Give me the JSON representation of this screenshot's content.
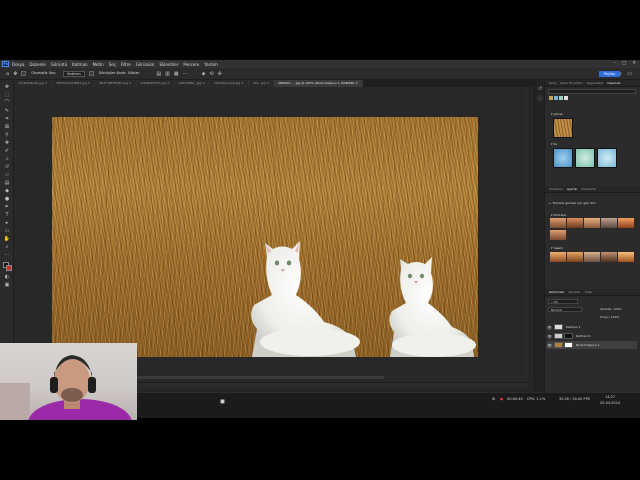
{
  "menubar": {
    "app_icon": "Ps",
    "items": [
      "Dosya",
      "Düzenle",
      "Görüntü",
      "Katman",
      "Metin",
      "Seç",
      "Filtre",
      "Görünüm",
      "Eklentiler",
      "Pencere",
      "Yardım"
    ],
    "window_controls": [
      "–",
      "□",
      "✕"
    ]
  },
  "options": {
    "sample": "Otomatik Seç:",
    "layer_mode": "Katman",
    "show_transform": "Dönüşüm Kontr. Göster",
    "share_label": "Paylaş"
  },
  "tabs": [
    {
      "label": "2376f0d4e4b.jpg ✕",
      "active": false
    },
    {
      "label": "4EF0C01A53B8A.jpg ✕",
      "active": false
    },
    {
      "label": "9B2F4EEEFABD.jpg ✕",
      "active": false
    },
    {
      "label": "2CDB4DAFF1.jpg ✕",
      "active": false
    },
    {
      "label": "1E8C9AB0_.jpg ✕",
      "active": false
    },
    {
      "label": "c5e2f49e-ba6.jpg ✕",
      "active": false
    },
    {
      "label": "c69...jpg ✕",
      "active": false
    },
    {
      "label": "AB8263-..., jpg @ 100% (Renk Dolgusu 1, RGB/8#) ✕",
      "active": true
    }
  ],
  "status": {
    "zoom": "100%"
  },
  "right_panel": {
    "top_tabs": [
      "Renk",
      "Renk Örnekleri",
      "Degradeler",
      "Desenler"
    ],
    "pattern_groups": [
      {
        "name": "Çimen"
      },
      {
        "name": "Su"
      }
    ],
    "mid_tabs": [
      "Özellikler",
      "Ayarlar",
      "Kitaplıklar"
    ],
    "adjust_header": "Tümünü gizmek için geri dön",
    "adjust_groups": [
      "Portreler",
      "Yaşam"
    ],
    "layers_tabs": [
      "Katmanlar",
      "Kanallar",
      "Yollar"
    ],
    "blend_mode": "Normal",
    "opacity_label": "Opaklık: 100%",
    "fill_label": "Dolgu: 100%",
    "layers": [
      {
        "name": "Katman 1",
        "selected": false
      },
      {
        "name": "Katman 0",
        "selected": false
      },
      {
        "name": "Renk Dolgusu 1",
        "selected": true
      }
    ]
  },
  "taskbar": {
    "time": "14:27",
    "date": "25.04.2024",
    "cpu": "CPU: 1.1%",
    "fps": "30.00 / 30.00 FPS",
    "rec": "00:00:40"
  },
  "colors": {
    "canvas_grass": "#ad7e36",
    "accent_blue": "#2f6fd8",
    "rec_red": "#e33"
  }
}
